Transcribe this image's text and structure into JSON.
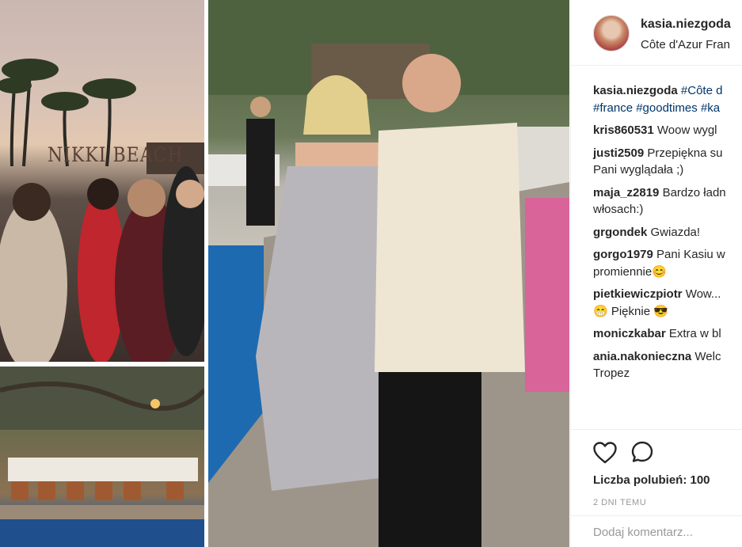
{
  "post": {
    "username": "kasia.niezgoda",
    "location": "Côte d'Azur Fran"
  },
  "photos": {
    "sign_text": "NIKKI BEACH"
  },
  "comments": [
    {
      "user": "kasia.niezgoda",
      "parts": [
        "#Côte d"
      ],
      "line2": [
        "#france",
        "#goodtimes",
        "#ka"
      ]
    },
    {
      "user": "kris860531",
      "text": "Woow wygl"
    },
    {
      "user": "justi2509",
      "text": "Przepiękna su",
      "line2": "Pani wyglądała ;)"
    },
    {
      "user": "maja_z2819",
      "text": "Bardzo ładn",
      "line2": "włosach:)"
    },
    {
      "user": "grgondek",
      "text": "Gwiazda!"
    },
    {
      "user": "gorgo1979",
      "text": "Pani Kasiu w",
      "line2": "promiennie😊"
    },
    {
      "user": "pietkiewiczpiotr",
      "text": "Wow...",
      "line2": "😁 Pięknie 😎"
    },
    {
      "user": "moniczkabar",
      "text": "Extra w bl"
    },
    {
      "user": "ania.nakonieczna",
      "text": "Welc",
      "line2": "Tropez"
    }
  ],
  "actions": {
    "likes_label": "Liczba polubień: 100",
    "time_label": "2 DNI TEMU"
  },
  "comment_input": {
    "placeholder": "Dodaj komentarz..."
  },
  "icons": {
    "like": "heart-icon",
    "comment": "comment-bubble-icon"
  }
}
